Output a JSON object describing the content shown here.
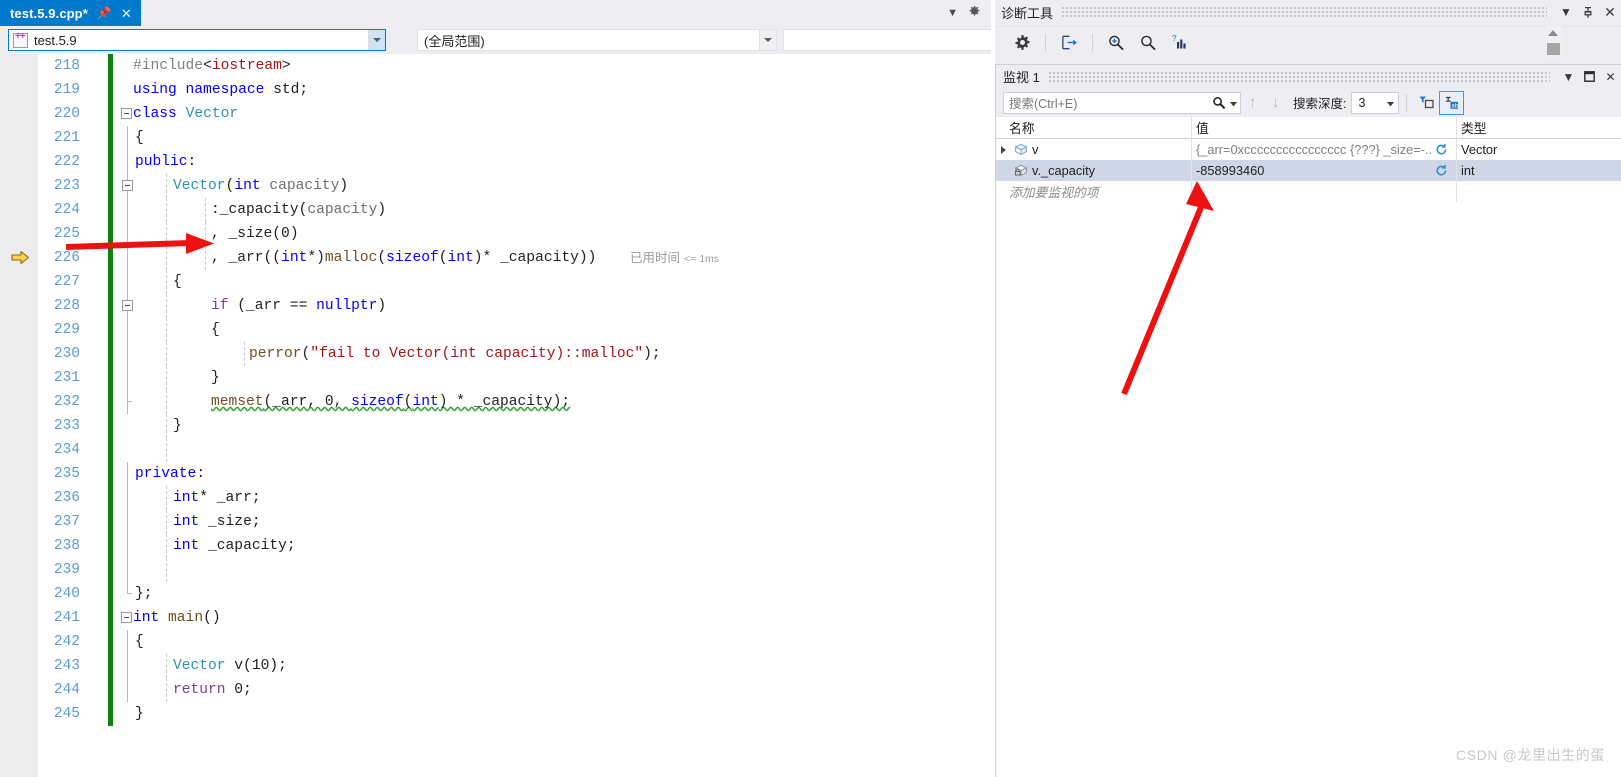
{
  "editor": {
    "tab": {
      "title": "test.5.9.cpp*",
      "pin_icon": "pin-icon",
      "close_icon": "close-icon"
    },
    "tabstrip_right": {
      "overflow_icon": "chevron-down-icon",
      "settings_icon": "gear-icon"
    },
    "navbar": {
      "project": "test.5.9",
      "scope": "(全局范围)",
      "member": "",
      "split_icon": "split-window-icon"
    },
    "elapsed_annotation": {
      "label": "已用时间",
      "value": "<= 1ms"
    },
    "lines": [
      {
        "n": "218",
        "indent": 0
      },
      {
        "n": "219",
        "indent": 0
      },
      {
        "n": "220",
        "indent": 0
      },
      {
        "n": "221",
        "indent": 0
      },
      {
        "n": "222",
        "indent": 0
      },
      {
        "n": "223",
        "indent": 0
      },
      {
        "n": "224",
        "indent": 0
      },
      {
        "n": "225",
        "indent": 0
      },
      {
        "n": "226",
        "indent": 0
      },
      {
        "n": "227",
        "indent": 0
      },
      {
        "n": "228",
        "indent": 0
      },
      {
        "n": "229",
        "indent": 0
      },
      {
        "n": "230",
        "indent": 0
      },
      {
        "n": "231",
        "indent": 0
      },
      {
        "n": "232",
        "indent": 0
      },
      {
        "n": "233",
        "indent": 0
      },
      {
        "n": "234",
        "indent": 0
      },
      {
        "n": "235",
        "indent": 0
      },
      {
        "n": "236",
        "indent": 0
      },
      {
        "n": "237",
        "indent": 0
      },
      {
        "n": "238",
        "indent": 0
      },
      {
        "n": "239",
        "indent": 0
      },
      {
        "n": "240",
        "indent": 0
      },
      {
        "n": "241",
        "indent": 0
      },
      {
        "n": "242",
        "indent": 0
      },
      {
        "n": "243",
        "indent": 0
      },
      {
        "n": "244",
        "indent": 0
      },
      {
        "n": "245",
        "indent": 0
      }
    ],
    "code_text": {
      "l218": "#include<iostream>",
      "l219": "using namespace std;",
      "l220": "class Vector",
      "l221": "{",
      "l222": "public:",
      "l223": "Vector(int capacity)",
      "l224": ":_capacity(capacity)",
      "l225": ", _size(0)",
      "l226": ", _arr((int*)malloc(sizeof(int)* _capacity))",
      "l227": "{",
      "l228": "if (_arr == nullptr)",
      "l229": "{",
      "l230": "perror(\"fail to Vector(int capacity)::malloc\");",
      "l231": "}",
      "l232": "memset(_arr, 0, sizeof(int) * _capacity);",
      "l233": "}",
      "l234": "",
      "l235": "private:",
      "l236": "int* _arr;",
      "l237": "int _size;",
      "l238": "int _capacity;",
      "l239": "",
      "l240": "};",
      "l241": "int main()",
      "l242": "{",
      "l243": "Vector v(10);",
      "l244": "return 0;",
      "l245": "}"
    }
  },
  "diagnostics": {
    "title": "诊断工具",
    "header_icons": [
      "chevron-down-icon",
      "pin-icon",
      "close-icon"
    ],
    "toolbar": [
      {
        "name": "settings-button",
        "icon": "gear-icon"
      },
      {
        "name": "export-button",
        "icon": "export-icon"
      },
      {
        "name": "zoom-in-button",
        "icon": "zoom-in-icon"
      },
      {
        "name": "zoom-out-button",
        "icon": "zoom-out-icon"
      },
      {
        "name": "show-chart-button",
        "icon": "chart-help-icon"
      }
    ]
  },
  "watch": {
    "title": "监视 1",
    "header_icons": [
      "chevron-down-icon",
      "maximize-icon",
      "close-icon"
    ],
    "search": {
      "placeholder": "搜索(Ctrl+E)",
      "search_icon": "search-icon",
      "dropdown_icon": "chevron-down-icon",
      "prev_icon": "arrow-up-icon",
      "next_icon": "arrow-down-icon"
    },
    "depth": {
      "label": "搜索深度:",
      "value": "3"
    },
    "toggles": [
      {
        "name": "filter-pin-toggle",
        "icon": "filter-pin-icon",
        "active": false
      },
      {
        "name": "show-type-columns-toggle",
        "icon": "columns-ab-icon",
        "active": true
      }
    ],
    "columns": [
      "名称",
      "值",
      "类型"
    ],
    "rows": [
      {
        "expandable": true,
        "icon": "object-icon",
        "name": "v",
        "value": "{_arr=0xcccccccccccccccc {???} _size=-...",
        "value_gray": true,
        "refresh_icon": "refresh-icon",
        "type": "Vector",
        "selected": false
      },
      {
        "expandable": false,
        "icon": "private-object-icon",
        "name": "v._capacity",
        "value": "-858993460",
        "value_gray": false,
        "refresh_icon": "refresh-icon",
        "type": "int",
        "selected": true
      }
    ],
    "add_item_placeholder": "添加要监视的项"
  },
  "watermark": "CSDN @龙里出生的蛋",
  "colors": {
    "tab_active": "#007acc",
    "chrome": "#eeeef2",
    "changebar_green": "#108010",
    "selection": "#cfd6e6",
    "annotation_red": "#ee1111",
    "keyword_blue": "#0000ff",
    "type_teal": "#2b91af",
    "string_red": "#a31515",
    "linenum": "#5a9bd5"
  }
}
